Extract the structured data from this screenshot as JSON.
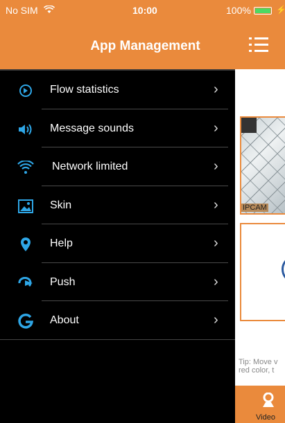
{
  "status_bar": {
    "carrier": "No SIM",
    "time": "10:00",
    "battery": "100%",
    "battery_icon": "battery-charging-icon",
    "wifi_icon": "wifi-icon"
  },
  "drawer": {
    "title": "App Management",
    "items": [
      {
        "label": "Flow statistics",
        "icon": "flow-statistics-icon"
      },
      {
        "label": "Message sounds",
        "icon": "speaker-icon"
      },
      {
        "label": "Network limited",
        "icon": "wifi-icon"
      },
      {
        "label": "Skin",
        "icon": "image-icon"
      },
      {
        "label": "Help",
        "icon": "location-pin-icon"
      },
      {
        "label": "Push",
        "icon": "push-icon"
      },
      {
        "label": "About",
        "icon": "about-g-icon"
      }
    ]
  },
  "main": {
    "camera_label": "IPCAM",
    "tip": "Tip: Move v\nred color, t",
    "bottom_tab": "Video"
  },
  "colors": {
    "accent": "#ea8a3c",
    "icon_blue": "#2ea6e6",
    "drawer_bg": "#000000"
  }
}
